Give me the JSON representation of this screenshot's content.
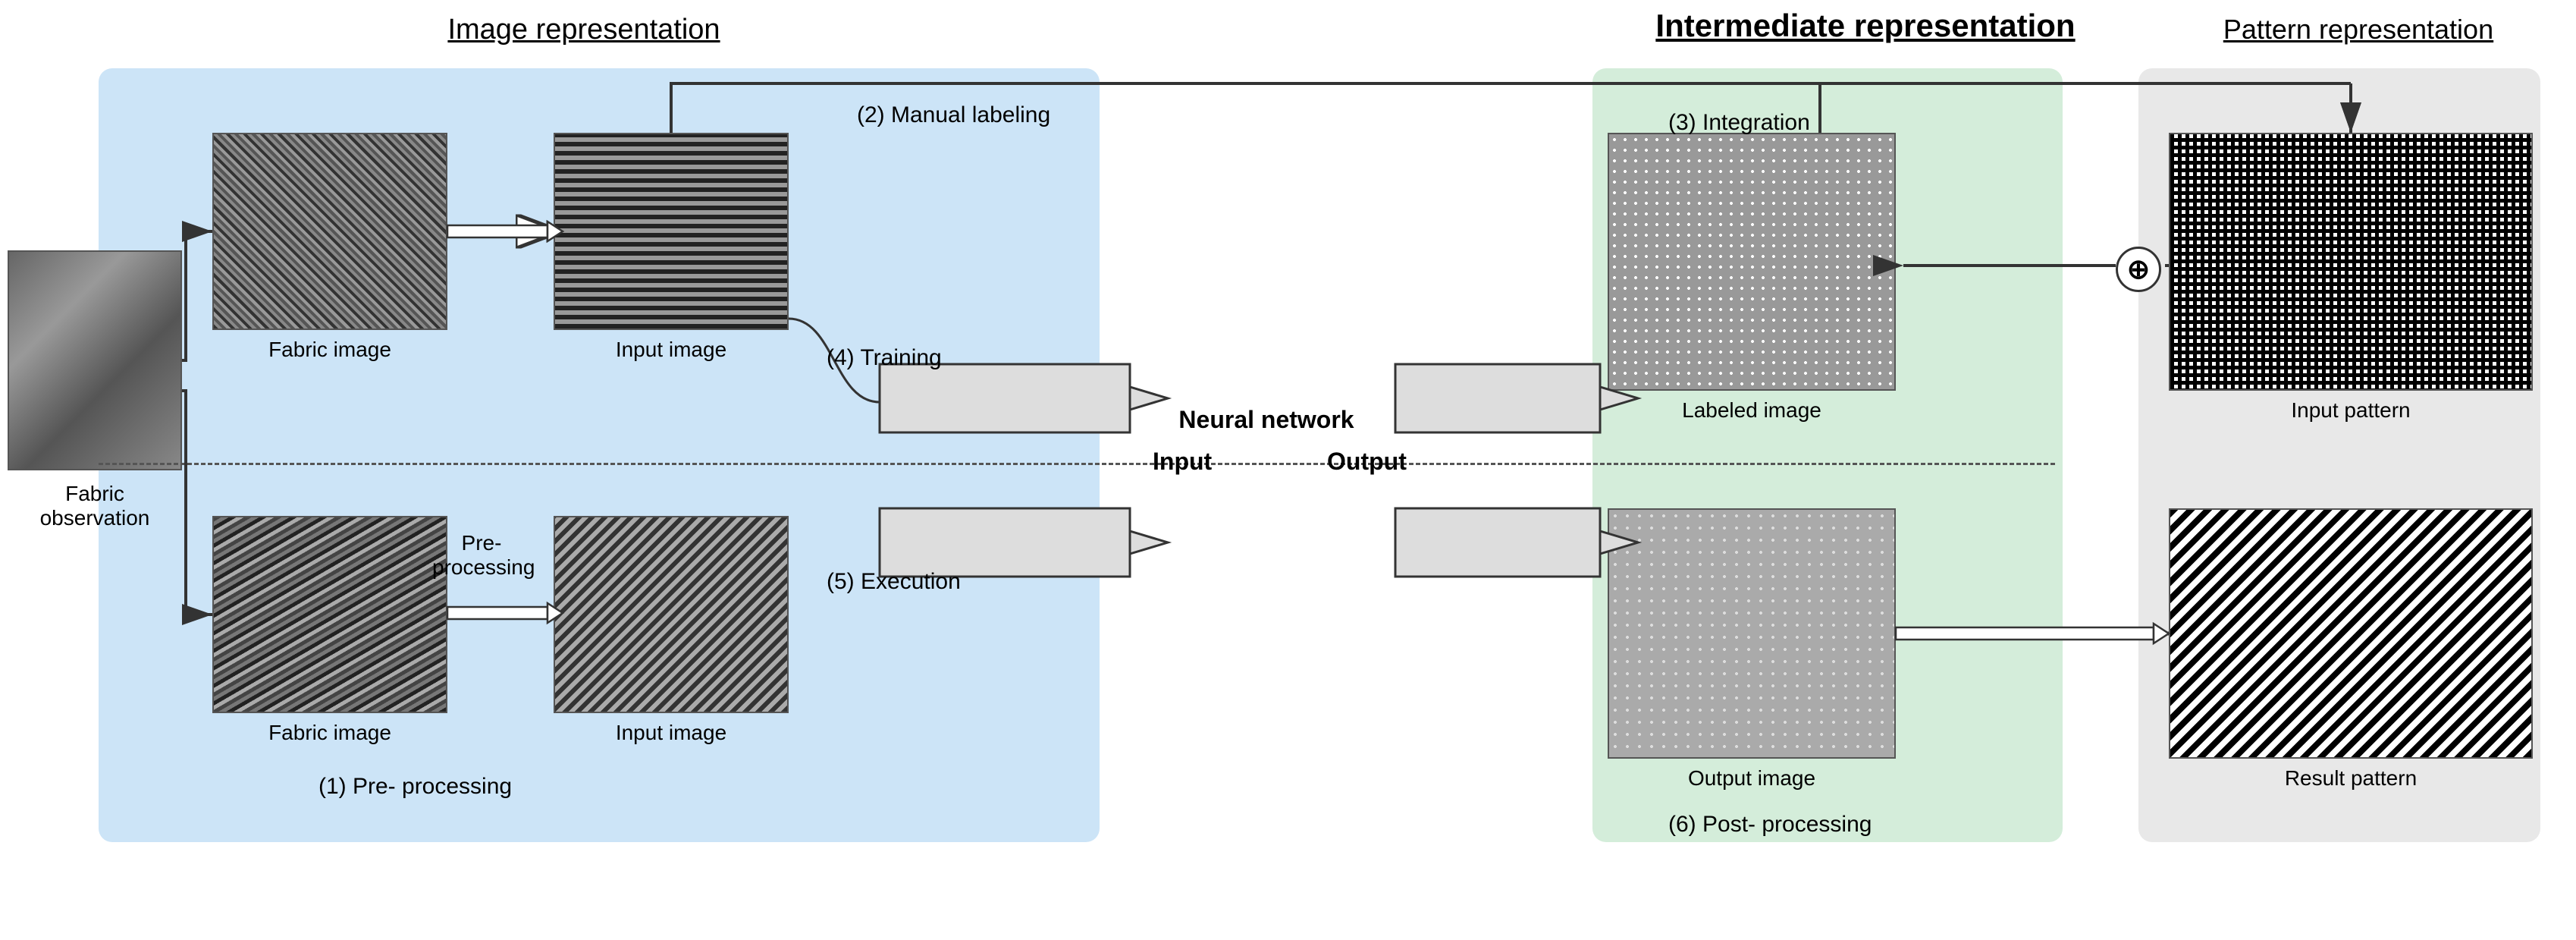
{
  "titles": {
    "image_rep": "Image\nrepresentation",
    "intermediate_rep": "Intermediate\nrepresentation",
    "pattern_rep": "Pattern\nrepresentation"
  },
  "labels": {
    "fabric_observation": "Fabric observation",
    "fabric_image_top": "Fabric image",
    "input_image_top": "Input image",
    "fabric_image_bottom": "Fabric image",
    "input_image_bottom": "Input image",
    "labeled_image": "Labeled image",
    "output_image": "Output image",
    "input_pattern": "Input pattern",
    "result_pattern": "Result pattern",
    "neural_network": "Neural\nnetwork",
    "input": "Input",
    "output": "Output",
    "step1": "(1) Pre- processing",
    "step2": "(2) Manual labeling",
    "step3": "(3) Integration",
    "step4": "(4) Training",
    "step5": "(5) Execution",
    "step6": "(6) Post- processing",
    "preprocessing": "Pre-\nprocessing"
  }
}
